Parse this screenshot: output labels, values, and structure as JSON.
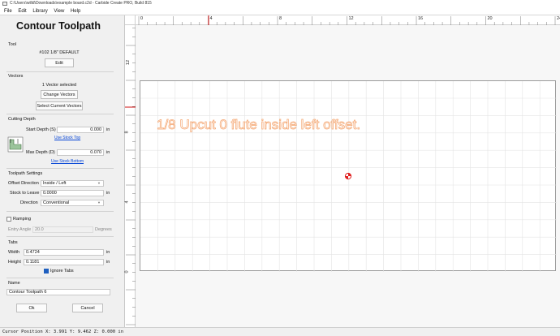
{
  "window": {
    "title": "C:\\Users\\willd\\Downloads\\example board.c2d - Carbide Create PRO, Build 815"
  },
  "menu": [
    "File",
    "Edit",
    "Library",
    "View",
    "Help"
  ],
  "panel": {
    "title": "Contour Toolpath",
    "tool": {
      "heading": "Tool",
      "name": "#102 1/8\" DEFAULT",
      "edit_label": "Edit"
    },
    "vectors": {
      "heading": "Vectors",
      "count_text": "1 Vector selected",
      "change_label": "Change Vectors",
      "select_label": "Select Current Vectors"
    },
    "cutting_depth": {
      "heading": "Cutting Depth",
      "start_label": "Start Depth (S)",
      "start_value": "0.000",
      "start_unit": "in",
      "use_stock_top": "Use Stock Top",
      "max_label": "Max Depth (D)",
      "max_value": "0.070",
      "max_unit": "in",
      "use_stock_bottom": "Use Stock Bottom"
    },
    "toolpath_settings": {
      "heading": "Toolpath Settings",
      "offset_label": "Offset Direction",
      "offset_value": "Inside / Left",
      "stock_label": "Stock to Leave",
      "stock_value": "0.0000",
      "stock_unit": "in",
      "direction_label": "Direction",
      "direction_value": "Conventional"
    },
    "ramping": {
      "label": "Ramping",
      "checked": false,
      "entry_label": "Entry Angle",
      "entry_value": "20.0",
      "entry_unit": "Degrees"
    },
    "tabs": {
      "heading": "Tabs",
      "width_label": "Width",
      "width_value": "0.4724",
      "width_unit": "in",
      "height_label": "Height",
      "height_value": "0.1181",
      "height_unit": "in",
      "ignore_label": "Ignore Tabs",
      "ignore_checked": true
    },
    "name": {
      "heading": "Name",
      "value": "Contour Toolpath 6"
    },
    "ok_label": "Ok",
    "cancel_label": "Cancel"
  },
  "canvas": {
    "ruler_x_labels": [
      "0",
      "4",
      "8",
      "12",
      "16",
      "20",
      "24"
    ],
    "ruler_y_labels": [
      "12",
      "8",
      "4",
      "0"
    ],
    "text": "1/8 Upcut 0 flute inside left offset.",
    "text_color": "#f4a36c",
    "marker_color": "#e02020"
  },
  "status": {
    "text": "Cursor Position X: 3.991 Y: 9.462 Z: 0.000 in"
  }
}
